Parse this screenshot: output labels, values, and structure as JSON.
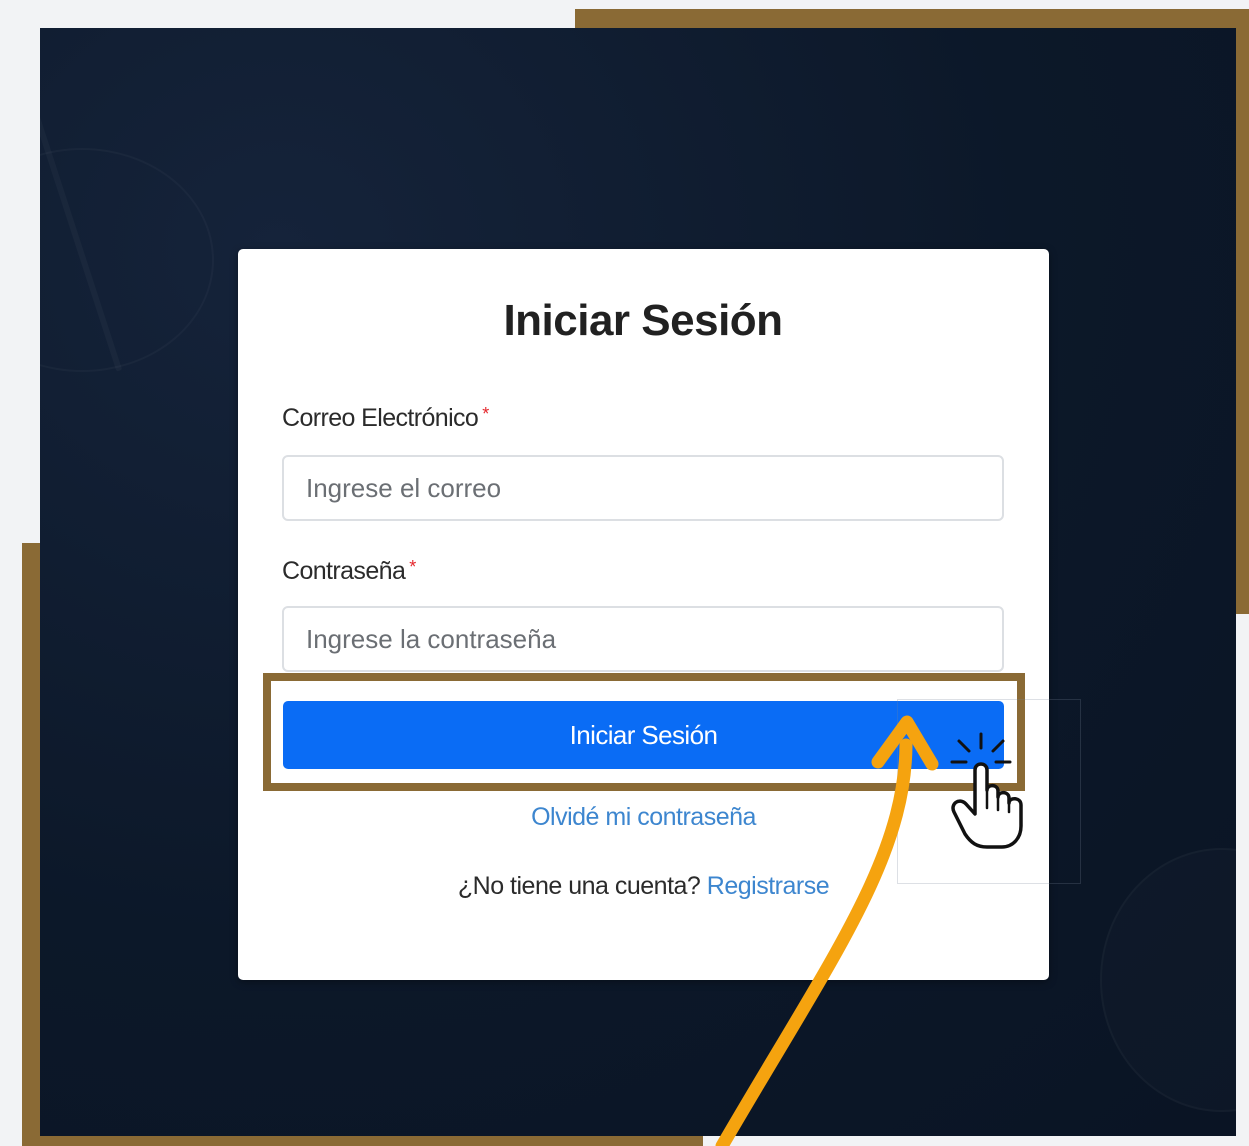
{
  "login": {
    "title": "Iniciar Sesión",
    "email_label": "Correo Electrónico",
    "email_required": "*",
    "email_placeholder": "Ingrese el correo",
    "email_value": "",
    "password_label": "Contraseña",
    "password_required": "*",
    "password_placeholder": "Ingrese la contraseña",
    "password_value": "",
    "submit_label": "Iniciar Sesión",
    "forgot_label": "Olvidé mi contraseña",
    "no_account_text": "¿No tiene una cuenta?",
    "register_label": "Registrarse"
  },
  "annotation": {
    "arrow_icon": "curved-arrow-icon",
    "cursor_icon": "hand-pointer-click-icon"
  },
  "colors": {
    "gold_frame": "#8a6a35",
    "dark_background": "#0c1829",
    "primary_button": "#0a6cf5",
    "link": "#3d86cf",
    "arrow": "#f5a30f",
    "required_marker": "#e4262b"
  }
}
